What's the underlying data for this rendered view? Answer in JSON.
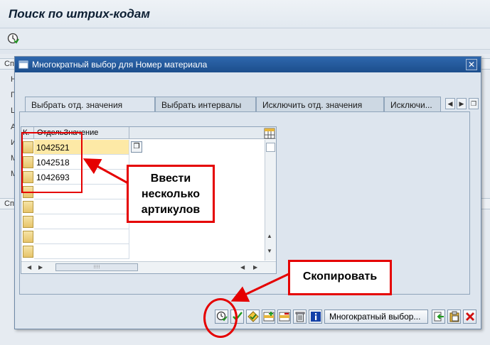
{
  "screen": {
    "title": "Поиск по штрих-кодам",
    "section_1_label": "Сп",
    "section_2_label": "Сп",
    "side_letters": [
      "Н",
      "П",
      "L",
      "А",
      "И",
      "М",
      "М"
    ]
  },
  "dialog": {
    "title": "Многократный выбор для Номер материала",
    "close_label": "✕",
    "tabs": [
      {
        "label": "Выбрать отд. значения",
        "active": true
      },
      {
        "label": "Выбрать интервалы",
        "active": false
      },
      {
        "label": "Исключить отд. значения",
        "active": false
      },
      {
        "label": "Исключи...",
        "active": false
      }
    ],
    "grid": {
      "col_select": "К.",
      "col_value": "ОтдельЗначение",
      "values": [
        "1042521",
        "1042518",
        "1042693",
        "",
        "",
        "",
        "",
        ""
      ],
      "scroll_grip": "⁝⁝⁝⁝"
    },
    "buttons": {
      "multi_select_label": "Многократный выбор..."
    }
  },
  "annotations": {
    "callout_enter": "Ввести несколько артикулов",
    "callout_copy": "Скопировать"
  },
  "colors": {
    "highlight": "#e50000",
    "title_bar": "#1c4e8c"
  }
}
